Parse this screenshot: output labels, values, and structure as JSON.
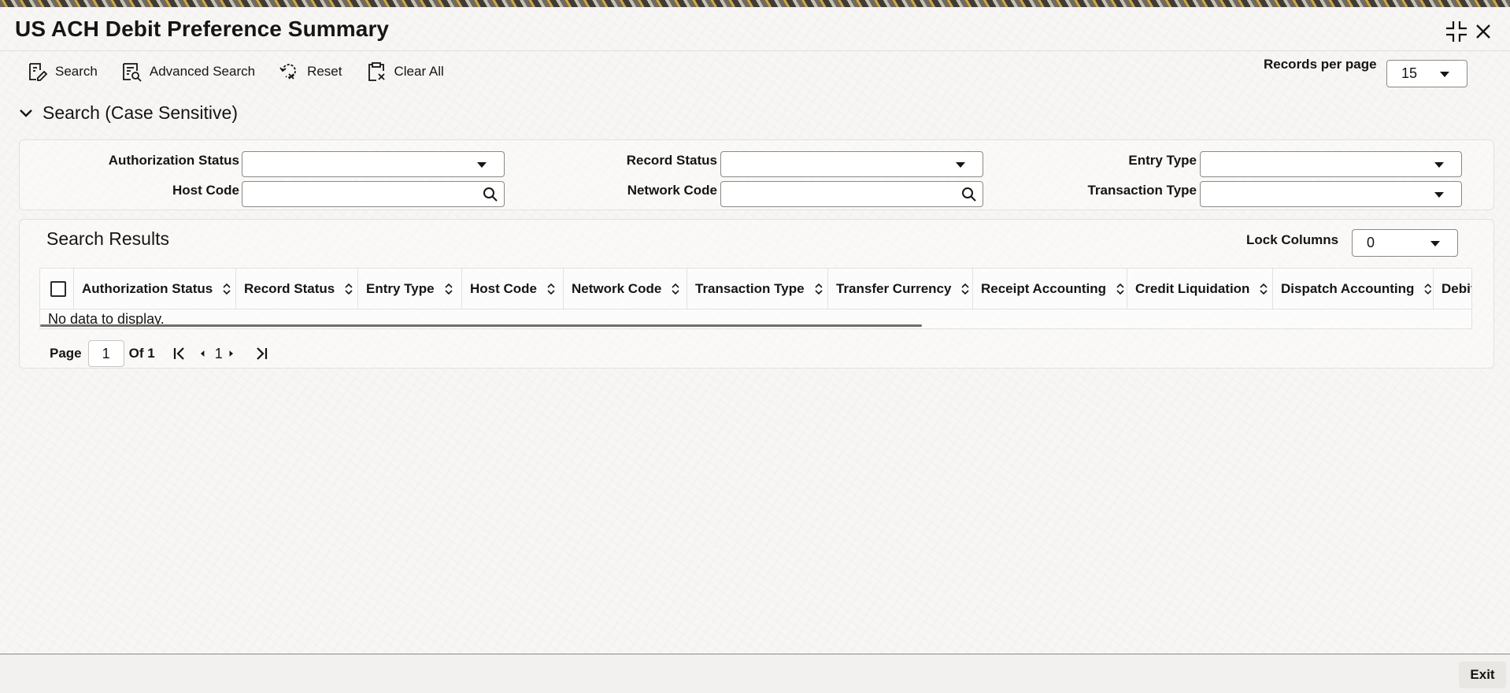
{
  "window": {
    "title": "US ACH Debit Preference Summary",
    "icons": {
      "restore": "shrink-icon",
      "close": "close-icon"
    }
  },
  "toolbar": {
    "search_label": "Search",
    "advanced_search_label": "Advanced Search",
    "reset_label": "Reset",
    "clear_all_label": "Clear All"
  },
  "records_per_page": {
    "label": "Records per page",
    "value": "15"
  },
  "search_section": {
    "title": "Search (Case Sensitive)",
    "fields": {
      "authorization_status": {
        "label": "Authorization Status",
        "value": ""
      },
      "record_status": {
        "label": "Record Status",
        "value": ""
      },
      "entry_type": {
        "label": "Entry Type",
        "value": ""
      },
      "host_code": {
        "label": "Host Code",
        "value": ""
      },
      "network_code": {
        "label": "Network Code",
        "value": ""
      },
      "transaction_type": {
        "label": "Transaction Type",
        "value": ""
      }
    }
  },
  "results": {
    "title": "Search Results",
    "lock_columns": {
      "label": "Lock Columns",
      "value": "0"
    },
    "columns": [
      "Authorization Status",
      "Record Status",
      "Entry Type",
      "Host Code",
      "Network Code",
      "Transaction Type",
      "Transfer Currency",
      "Receipt Accounting",
      "Credit Liquidation",
      "Dispatch Accounting",
      "Debit"
    ],
    "empty_message": "No data to display."
  },
  "pager": {
    "page_label": "Page",
    "current_page": "1",
    "of_label": "Of 1",
    "page_number": "1"
  },
  "footer": {
    "exit_label": "Exit"
  },
  "colors": {
    "text": "#161513",
    "border": "#8b8985",
    "background": "#f7f6f4"
  }
}
